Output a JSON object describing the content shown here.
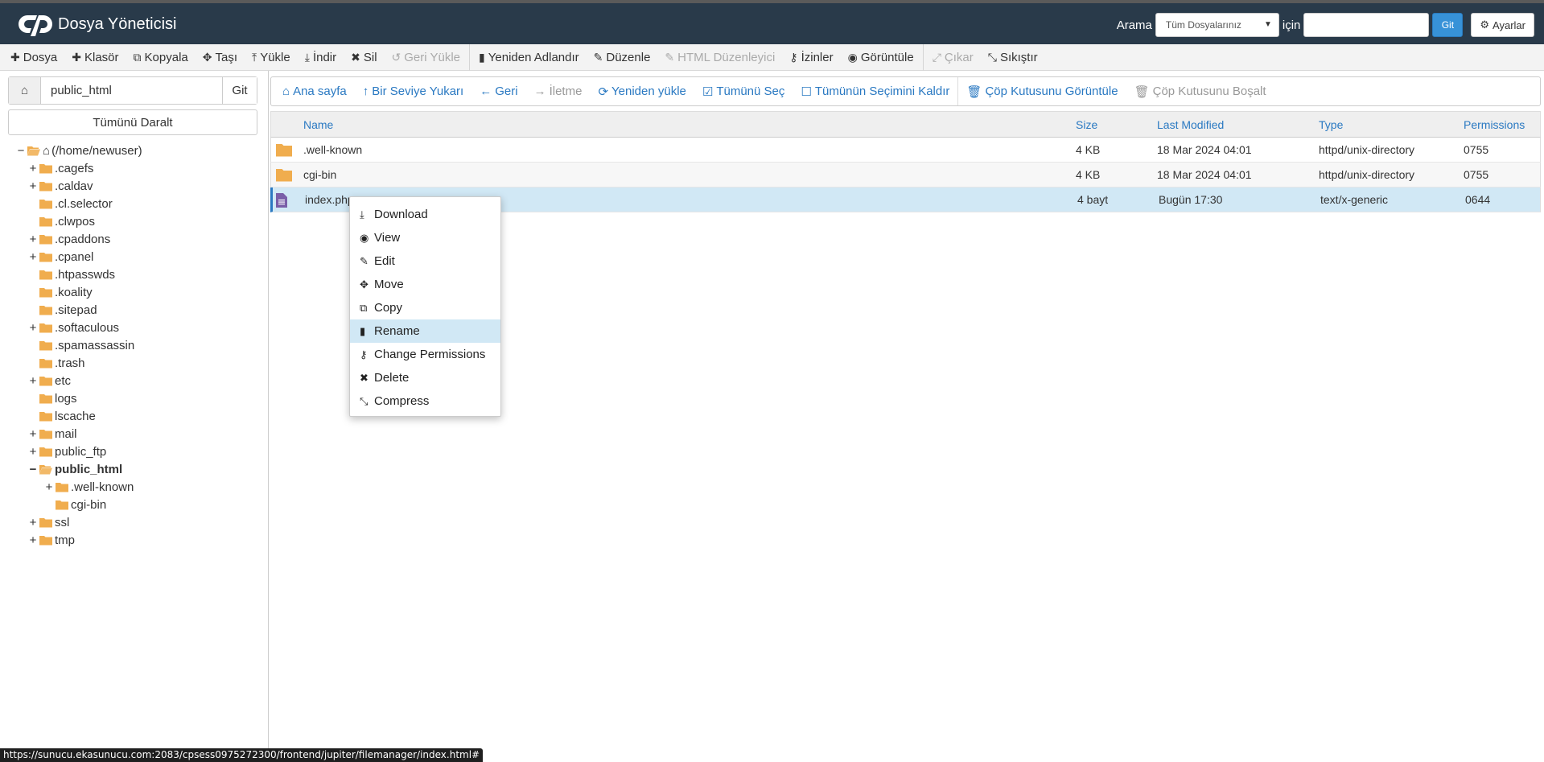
{
  "header": {
    "app_title": "Dosya Yöneticisi",
    "search_label": "Arama",
    "search_scope": "Tüm Dosyalarınız",
    "search_for_label": "için",
    "search_value": "",
    "go_label": "Git",
    "settings_label": "Ayarlar"
  },
  "toolbar": {
    "items": [
      {
        "label": "Dosya",
        "icon": "plus-icon"
      },
      {
        "label": "Klasör",
        "icon": "plus-icon"
      },
      {
        "label": "Kopyala",
        "icon": "copy-icon"
      },
      {
        "label": "Taşı",
        "icon": "move-icon"
      },
      {
        "label": "Yükle",
        "icon": "upload-icon"
      },
      {
        "label": "İndir",
        "icon": "download-icon"
      },
      {
        "label": "Sil",
        "icon": "close-icon"
      },
      {
        "label": "Geri Yükle",
        "icon": "undo-icon"
      },
      {
        "label": "Yeniden Adlandır",
        "icon": "file-icon"
      },
      {
        "label": "Düzenle",
        "icon": "pencil-icon"
      },
      {
        "label": "HTML Düzenleyici",
        "icon": "edit-icon"
      },
      {
        "label": "İzinler",
        "icon": "key-icon"
      },
      {
        "label": "Görüntüle",
        "icon": "eye-icon"
      },
      {
        "label": "Çıkar",
        "icon": "expand-icon"
      },
      {
        "label": "Sıkıştır",
        "icon": "compress-icon"
      }
    ]
  },
  "left_panel": {
    "path_value": "public_html",
    "go_label": "Git",
    "collapse_all_label": "Tümünü Daralt",
    "tree": [
      {
        "label": "(/home/newuser)",
        "toggle": "−",
        "type": "home"
      },
      {
        "label": ".cagefs",
        "toggle": "+"
      },
      {
        "label": ".caldav",
        "toggle": "+"
      },
      {
        "label": ".cl.selector",
        "toggle": ""
      },
      {
        "label": ".clwpos",
        "toggle": ""
      },
      {
        "label": ".cpaddons",
        "toggle": "+"
      },
      {
        "label": ".cpanel",
        "toggle": "+"
      },
      {
        "label": ".htpasswds",
        "toggle": ""
      },
      {
        "label": ".koality",
        "toggle": ""
      },
      {
        "label": ".sitepad",
        "toggle": ""
      },
      {
        "label": ".softaculous",
        "toggle": "+"
      },
      {
        "label": ".spamassassin",
        "toggle": ""
      },
      {
        "label": ".trash",
        "toggle": ""
      },
      {
        "label": "etc",
        "toggle": "+"
      },
      {
        "label": "logs",
        "toggle": ""
      },
      {
        "label": "lscache",
        "toggle": ""
      },
      {
        "label": "mail",
        "toggle": "+"
      },
      {
        "label": "public_ftp",
        "toggle": "+"
      },
      {
        "label": "public_html",
        "toggle": "−",
        "type": "open-bold"
      },
      {
        "label": ".well-known",
        "toggle": "+"
      },
      {
        "label": "cgi-bin",
        "toggle": ""
      },
      {
        "label": "ssl",
        "toggle": "+"
      },
      {
        "label": "tmp",
        "toggle": "+"
      }
    ]
  },
  "nav_bar": {
    "items": [
      {
        "label": "Ana sayfa",
        "icon": "home-icon"
      },
      {
        "label": "Bir Seviye Yukarı",
        "icon": "level-up-icon"
      },
      {
        "label": "Geri",
        "icon": "arrow-left-icon"
      },
      {
        "label": "İletme",
        "icon": "arrow-right-icon"
      },
      {
        "label": "Yeniden yükle",
        "icon": "refresh-icon"
      },
      {
        "label": "Tümünü Seç",
        "icon": "checkbox-checked-icon"
      },
      {
        "label": "Tümünün Seçimini Kaldır",
        "icon": "checkbox-empty-icon"
      },
      {
        "label": "Çöp Kutusunu Görüntüle",
        "icon": "trash-icon"
      },
      {
        "label": "Çöp Kutusunu Boşalt",
        "icon": "trash-icon"
      }
    ]
  },
  "file_table": {
    "columns": [
      "Name",
      "Size",
      "Last Modified",
      "Type",
      "Permissions"
    ],
    "rows": [
      {
        "name": ".well-known",
        "size": "4 KB",
        "modified": "18 Mar 2024 04:01",
        "type": "httpd/unix-directory",
        "perms": "0755",
        "kind": "folder"
      },
      {
        "name": "cgi-bin",
        "size": "4 KB",
        "modified": "18 Mar 2024 04:01",
        "type": "httpd/unix-directory",
        "perms": "0755",
        "kind": "folder"
      },
      {
        "name": "index.php",
        "size": "4 bayt",
        "modified": "Bugün 17:30",
        "type": "text/x-generic",
        "perms": "0644",
        "kind": "file"
      }
    ]
  },
  "context_menu": {
    "items": [
      {
        "label": "Download",
        "icon": "download-icon"
      },
      {
        "label": "View",
        "icon": "eye-icon"
      },
      {
        "label": "Edit",
        "icon": "pencil-icon"
      },
      {
        "label": "Move",
        "icon": "move-icon"
      },
      {
        "label": "Copy",
        "icon": "copy-icon"
      },
      {
        "label": "Rename",
        "icon": "file-icon"
      },
      {
        "label": "Change Permissions",
        "icon": "key-icon"
      },
      {
        "label": "Delete",
        "icon": "close-icon"
      },
      {
        "label": "Compress",
        "icon": "compress-icon"
      }
    ]
  },
  "status_url": "https://sunucu.ekasunucu.com:2083/cpsess0975272300/frontend/jupiter/filemanager/index.html#",
  "colors": {
    "header_bg": "#293a4a",
    "link": "#2a79c2",
    "folder": "#f0ad4e",
    "selected_row": "#d1e8f5"
  }
}
